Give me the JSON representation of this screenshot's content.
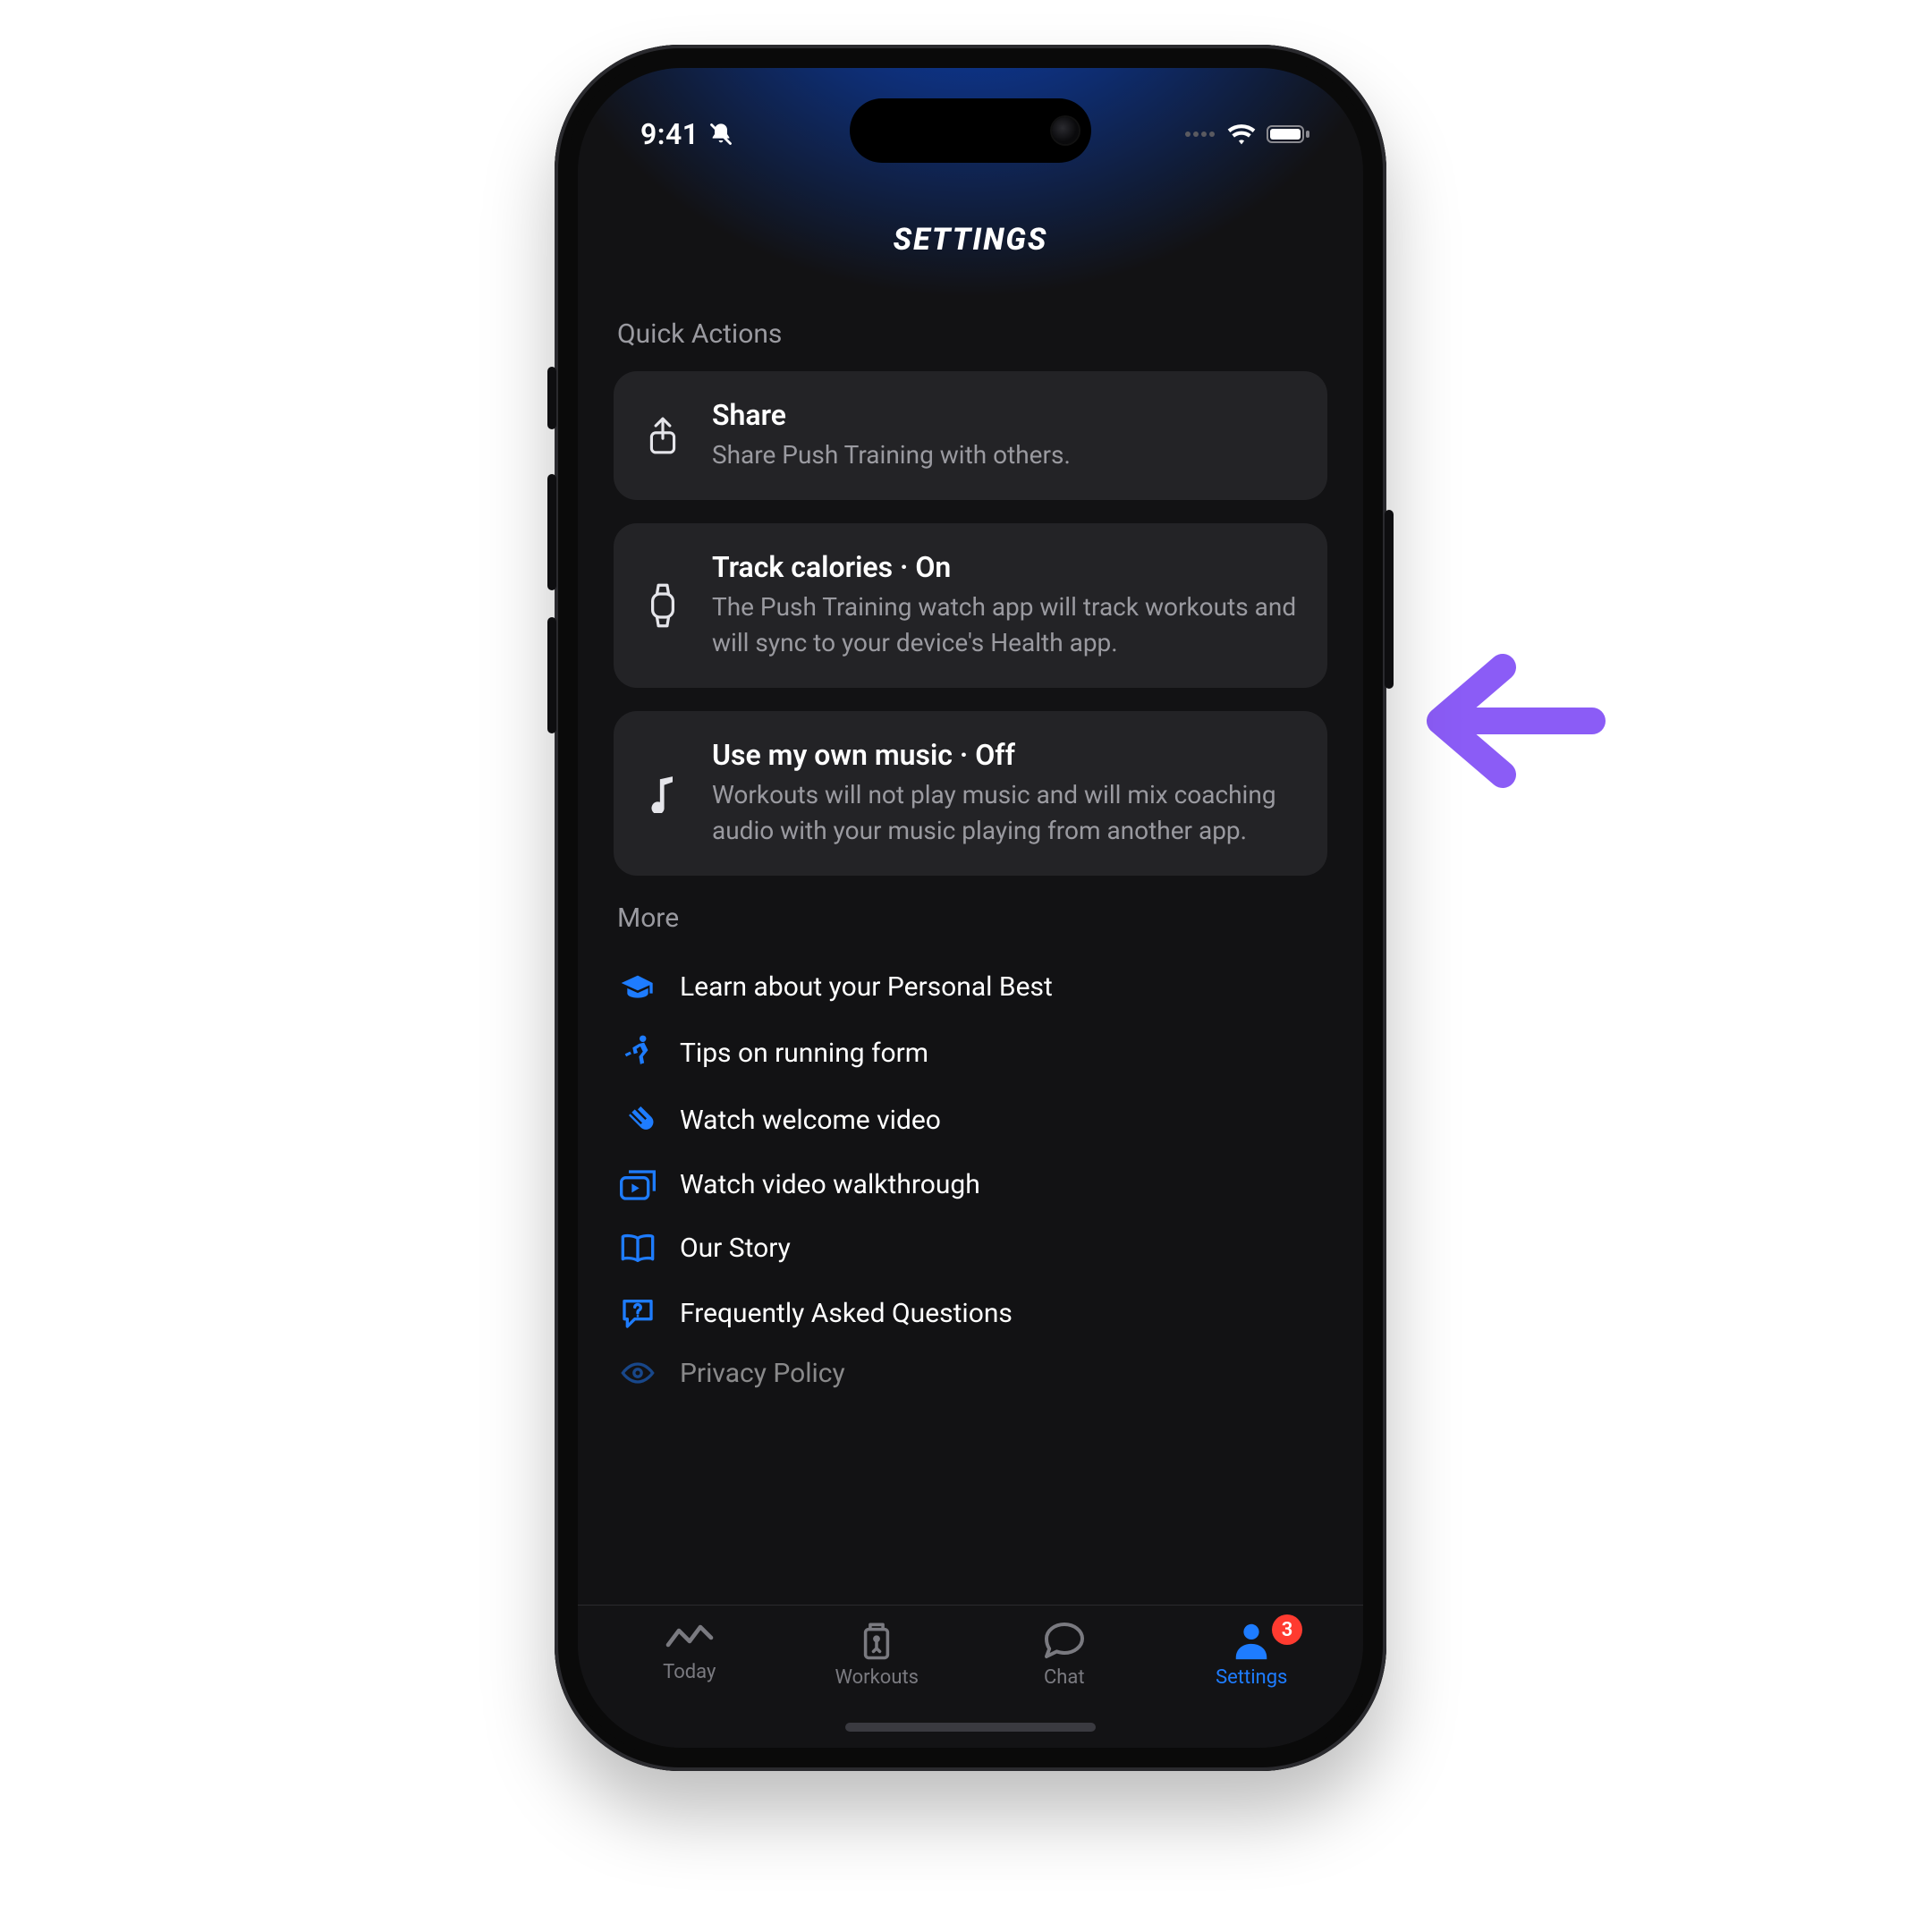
{
  "statusbar": {
    "time": "9:41"
  },
  "page": {
    "title": "SETTINGS"
  },
  "colors": {
    "accent": "#1e7cff",
    "arrow": "#8b5cf6",
    "badge": "#ff3b30"
  },
  "sections": {
    "quick_actions": {
      "header": "Quick Actions",
      "cards": [
        {
          "icon": "share-icon",
          "title": "Share",
          "desc": "Share Push Training with others."
        },
        {
          "icon": "watch-icon",
          "title": "Track calories · On",
          "desc": "The Push Training watch app will track workouts and will sync to your device's Health app."
        },
        {
          "icon": "music-note-icon",
          "title": "Use my own music · Off",
          "desc": "Workouts will not play music and will mix coaching audio with your music playing from another app."
        }
      ]
    },
    "more": {
      "header": "More",
      "items": [
        {
          "icon": "grad-cap-icon",
          "label": "Learn about your Personal Best"
        },
        {
          "icon": "runner-icon",
          "label": "Tips on running form"
        },
        {
          "icon": "clap-icon",
          "label": "Watch welcome video"
        },
        {
          "icon": "play-lib-icon",
          "label": "Watch video walkthrough"
        },
        {
          "icon": "book-icon",
          "label": "Our Story"
        },
        {
          "icon": "faq-icon",
          "label": "Frequently Asked Questions"
        },
        {
          "icon": "privacy-icon",
          "label": "Privacy Policy"
        }
      ]
    }
  },
  "tabs": [
    {
      "icon": "today-icon",
      "label": "Today",
      "active": false
    },
    {
      "icon": "workouts-icon",
      "label": "Workouts",
      "active": false
    },
    {
      "icon": "chat-icon",
      "label": "Chat",
      "active": false
    },
    {
      "icon": "settings-icon",
      "label": "Settings",
      "active": true,
      "badge": "3"
    }
  ]
}
